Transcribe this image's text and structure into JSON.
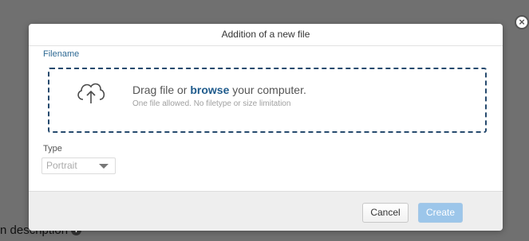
{
  "background": {
    "partial_label": "n description"
  },
  "modal": {
    "title": "Addition of a new file",
    "filename_label": "Filename",
    "dropzone": {
      "text_before": "Drag file or ",
      "browse_link": "browse",
      "text_after": " your computer.",
      "subtext": "One file allowed. No filetype or size limitation"
    },
    "type_label": "Type",
    "type_value": "Portrait",
    "buttons": {
      "cancel": "Cancel",
      "create": "Create"
    }
  },
  "icons": {
    "close": "close-icon",
    "upload": "cloud-upload-icon",
    "info": "info-icon",
    "dropdown": "chevron-down-icon"
  },
  "colors": {
    "overlay": "#707070",
    "link_blue": "#1f5b8c",
    "label_blue": "#2f6a94",
    "create_button": "#9cc6ea"
  }
}
